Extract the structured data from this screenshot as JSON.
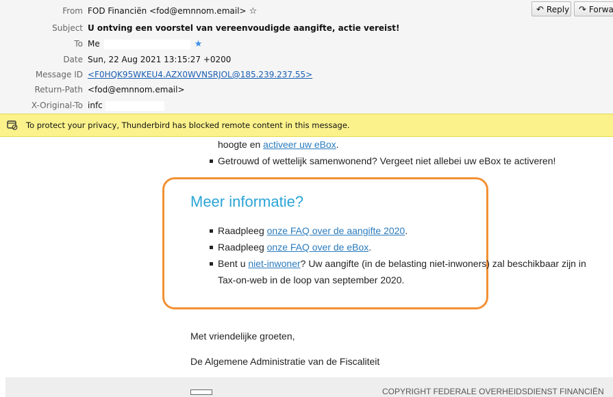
{
  "header": {
    "from": {
      "label": "From",
      "value": "FOD Financiën <fod@emnnom.email>"
    },
    "subject": {
      "label": "Subject",
      "value": "U ontving een voorstel van vereenvoudigde aangifte, actie vereist!"
    },
    "to": {
      "label": "To",
      "value": "Me"
    },
    "date": {
      "label": "Date",
      "value": "Sun, 22 Aug 2021 13:15:27 +0200"
    },
    "message_id": {
      "label": "Message ID",
      "value": "<F0HQK95WKEU4.AZX0WVNSRJOL@185.239.237.55>"
    },
    "return_path": {
      "label": "Return-Path",
      "value": "<fod@emnnom.email>"
    },
    "x_original_to": {
      "label": "X-Original-To",
      "value": "infc"
    },
    "reply_label": "Reply",
    "forward_label": "Forwar"
  },
  "privacy_bar": {
    "text": "To protect your privacy, Thunderbird has blocked remote content in this message."
  },
  "body": {
    "line1_prefix": "hoogte en ",
    "line1_link": "activeer uw eBox",
    "line1_suffix": ".",
    "bullet_married": "Getrouwd of wettelijk samenwonend? Vergeet niet allebei uw eBox te activeren!",
    "meer_title": "Meer informatie?",
    "b1_prefix": "Raadpleeg ",
    "b1_link": "onze FAQ over de aangifte 2020",
    "b1_suffix": ".",
    "b2_prefix": "Raadpleeg ",
    "b2_link": "onze FAQ over de eBox",
    "b2_suffix": ".",
    "b3_prefix": "Bent u ",
    "b3_link": "niet-inwoner",
    "b3_suffix": "? Uw aangifte (in de belasting niet-inwoners) zal beschikbaar zijn in",
    "b3_line2": "Tax-on-web in de loop van september 2020.",
    "greeting": "Met vriendelijke groeten,",
    "signature": "De Algemene Administratie van de Fiscaliteit"
  },
  "footer": {
    "copyright": "COPYRIGHT FEDERALE OVERHEIDSDIENST FINANCIËN"
  },
  "colors": {
    "privacy_bar": "#fbf28c",
    "link": "#2a7bbd",
    "heading": "#2aa4d6",
    "highlight_box": "#f39033"
  }
}
